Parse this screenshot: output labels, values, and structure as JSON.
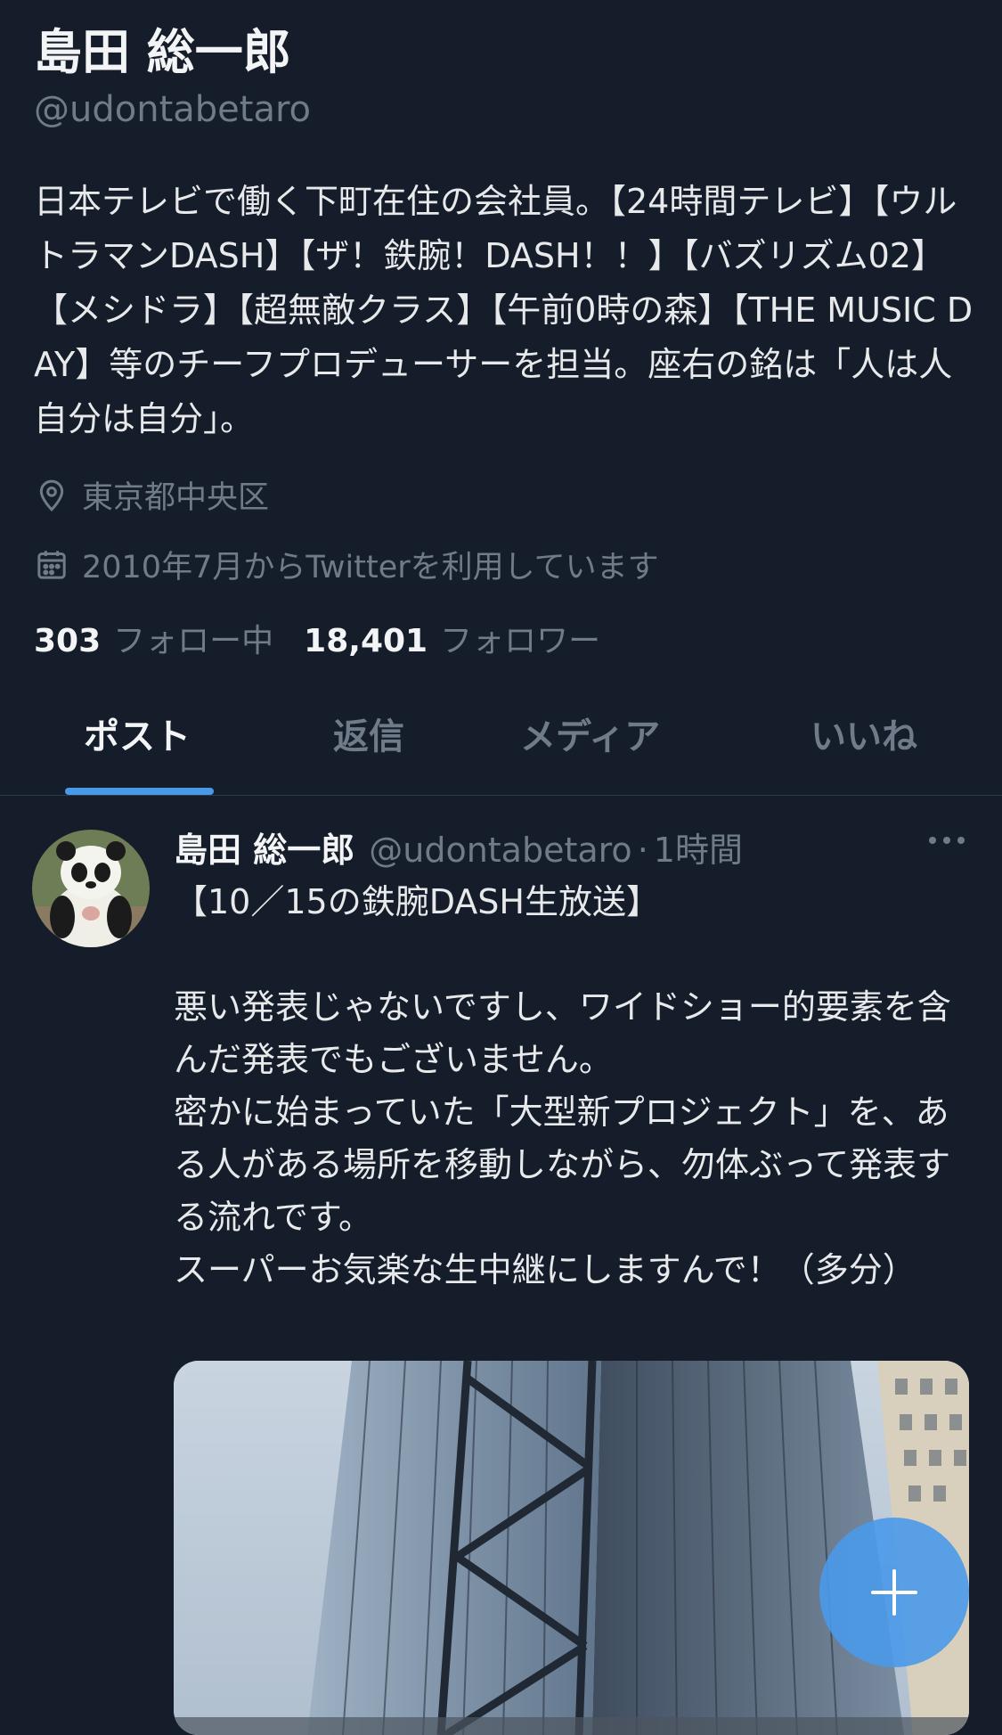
{
  "profile": {
    "display_name": "島田 総一郎",
    "handle": "@udontabetaro",
    "bio": "日本テレビで働く下町在住の会社員。【24時間テレビ】【ウルトラマンDASH】【ザ！鉄腕！DASH！！】【バズリズム02】【メシドラ】【超無敵クラス】【午前0時の森】【THE MUSIC DAY】等のチーフプロデューサーを担当。座右の銘は「人は人 自分は自分」。",
    "location": "東京都中央区",
    "joined": "2010年7月からTwitterを利用しています",
    "following_count": "303",
    "following_label": "フォロー中",
    "followers_count": "18,401",
    "followers_label": "フォロワー"
  },
  "tabs": [
    {
      "label": "ポスト",
      "active": true
    },
    {
      "label": "返信",
      "active": false
    },
    {
      "label": "メディア",
      "active": false
    },
    {
      "label": "いいね",
      "active": false
    }
  ],
  "post": {
    "name": "島田 総一郎",
    "handle": "@udontabetaro",
    "separator": "·",
    "time": "1時間",
    "text": "【10／15の鉄腕DASH生放送】\n\n悪い発表じゃないですし、ワイドショー的要素を含んだ発表でもございません。\n密かに始まっていた「大型新プロジェクト」を、ある人がある場所を移動しながら、勿体ぶって発表する流れです。\nスーパーお気楽な生中継にしますんで！（多分）"
  },
  "icons": {
    "location": "location-pin-icon",
    "calendar": "calendar-icon",
    "more": "more-icon",
    "compose": "plus-icon"
  },
  "colors": {
    "background": "#151d2a",
    "accent": "#4a99e9",
    "secondary_text": "#6f7b88",
    "primary_text": "#e7e9ea"
  }
}
